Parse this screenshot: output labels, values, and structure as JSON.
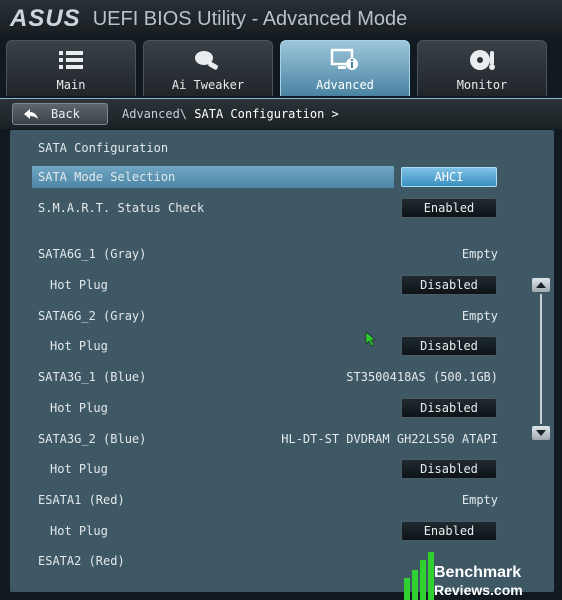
{
  "header": {
    "brand": "ASUS",
    "title": "UEFI BIOS Utility - Advanced Mode"
  },
  "tabs": [
    {
      "label": "Main",
      "icon": "list-icon"
    },
    {
      "label": "Ai Tweaker",
      "icon": "tweaker-icon"
    },
    {
      "label": "Advanced",
      "icon": "monitor-info-icon",
      "active": true
    },
    {
      "label": "Monitor",
      "icon": "thermometer-fan-icon"
    }
  ],
  "breadcrumb": {
    "back": "Back",
    "parent": "Advanced\\",
    "current": "SATA Configuration >"
  },
  "section_title": "SATA Configuration",
  "rows": [
    {
      "label": "SATA Mode Selection",
      "button": "AHCI"
    },
    {
      "label": "S.M.A.R.T. Status Check",
      "button": "Enabled"
    },
    {
      "label": "SATA6G_1 (Gray)",
      "value": "Empty"
    },
    {
      "label": "Hot Plug",
      "button": "Disabled"
    },
    {
      "label": "SATA6G_2 (Gray)",
      "value": "Empty"
    },
    {
      "label": "Hot Plug",
      "button": "Disabled"
    },
    {
      "label": "SATA3G_1 (Blue)",
      "value": "ST3500418AS (500.1GB)"
    },
    {
      "label": "Hot Plug",
      "button": "Disabled"
    },
    {
      "label": "SATA3G_2 (Blue)",
      "value": "HL-DT-ST DVDRAM GH22LS50 ATAPI"
    },
    {
      "label": "Hot Plug",
      "button": "Disabled"
    },
    {
      "label": "ESATA1 (Red)",
      "value": "Empty"
    },
    {
      "label": "Hot Plug",
      "button": "Enabled"
    },
    {
      "label": "ESATA2 (Red)"
    }
  ],
  "watermark": {
    "line1": "Benchmark",
    "line2": "Reviews.com"
  },
  "colors": {
    "accent": "#4d87a6",
    "panel": "#3f5865",
    "watermark": "#2fd12f"
  }
}
